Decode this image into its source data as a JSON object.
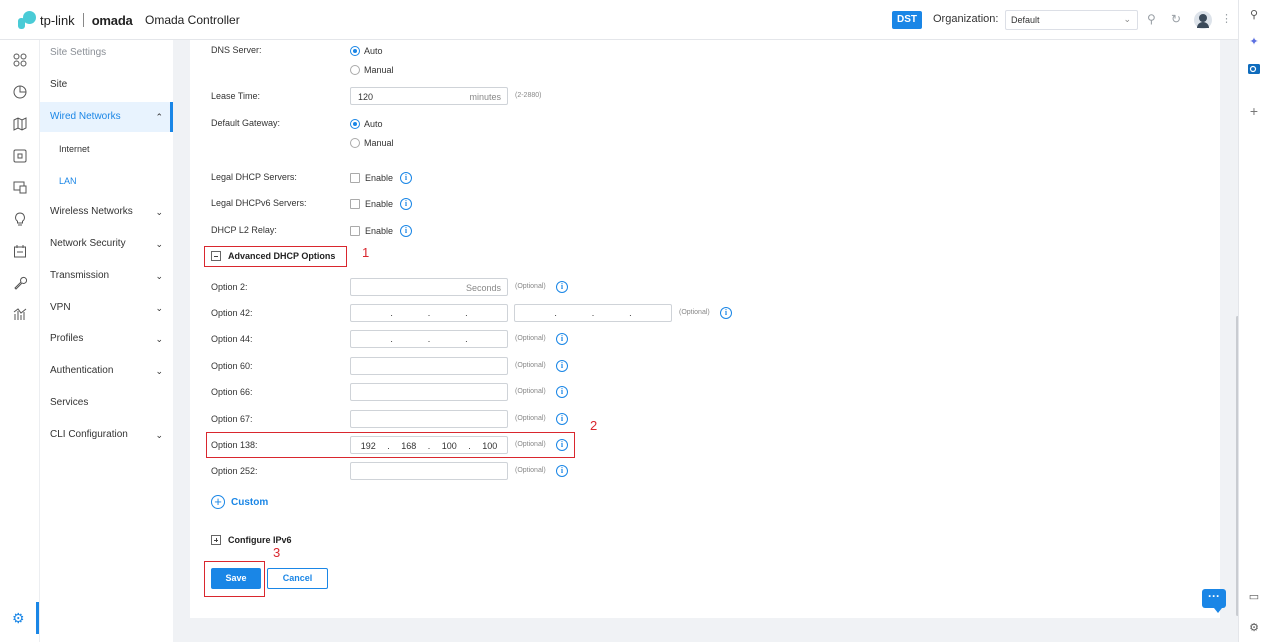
{
  "header": {
    "brand": "tp-link",
    "product": "omada",
    "app_title": "Omada Controller",
    "dst_badge": "DST",
    "org_label": "Organization:",
    "org_value": "Default"
  },
  "rail_icons": [
    "dashboard-icon",
    "statistics-icon",
    "map-icon",
    "devices-icon",
    "clients-icon",
    "insight-icon",
    "log-icon",
    "tools-icon",
    "reports-icon",
    "settings-icon"
  ],
  "sidebar": {
    "header": "Site Settings",
    "items": [
      {
        "label": "Site",
        "expandable": false
      },
      {
        "label": "Wired Networks",
        "expandable": true,
        "expanded": true
      },
      {
        "label": "Internet",
        "sub": true
      },
      {
        "label": "LAN",
        "sub": true,
        "selected": true
      },
      {
        "label": "Wireless Networks",
        "expandable": true
      },
      {
        "label": "Network Security",
        "expandable": true
      },
      {
        "label": "Transmission",
        "expandable": true
      },
      {
        "label": "VPN",
        "expandable": true
      },
      {
        "label": "Profiles",
        "expandable": true
      },
      {
        "label": "Authentication",
        "expandable": true
      },
      {
        "label": "Services",
        "expandable": false
      },
      {
        "label": "CLI Configuration",
        "expandable": true
      }
    ]
  },
  "form": {
    "dns_server": {
      "label": "DNS Server:",
      "options": [
        "Auto",
        "Manual"
      ],
      "selected": "Auto"
    },
    "lease_time": {
      "label": "Lease Time:",
      "value": "120",
      "unit": "minutes",
      "range": "(2-2880)"
    },
    "default_gateway": {
      "label": "Default Gateway:",
      "options": [
        "Auto",
        "Manual"
      ],
      "selected": "Auto"
    },
    "legal_dhcp": {
      "label": "Legal DHCP Servers:",
      "check_label": "Enable"
    },
    "legal_dhcpv6": {
      "label": "Legal DHCPv6 Servers:",
      "check_label": "Enable"
    },
    "dhcp_l2_relay": {
      "label": "DHCP L2 Relay:",
      "check_label": "Enable"
    },
    "advanced_title": "Advanced DHCP Options",
    "optional": "(Optional)",
    "option2": {
      "label": "Option 2:",
      "placeholder": "Seconds"
    },
    "option42": {
      "label": "Option 42:"
    },
    "option44": {
      "label": "Option 44:"
    },
    "option60": {
      "label": "Option 60:"
    },
    "option66": {
      "label": "Option 66:"
    },
    "option67": {
      "label": "Option 67:"
    },
    "option138": {
      "label": "Option 138:",
      "ip": [
        "192",
        "168",
        "100",
        "100"
      ]
    },
    "option252": {
      "label": "Option 252:"
    },
    "custom_label": "Custom",
    "ipv6_title": "Configure IPv6",
    "save_label": "Save",
    "cancel_label": "Cancel"
  },
  "annotations": [
    "1",
    "2",
    "3"
  ],
  "colors": {
    "accent": "#1a86e6",
    "annotation": "#d9272e"
  }
}
